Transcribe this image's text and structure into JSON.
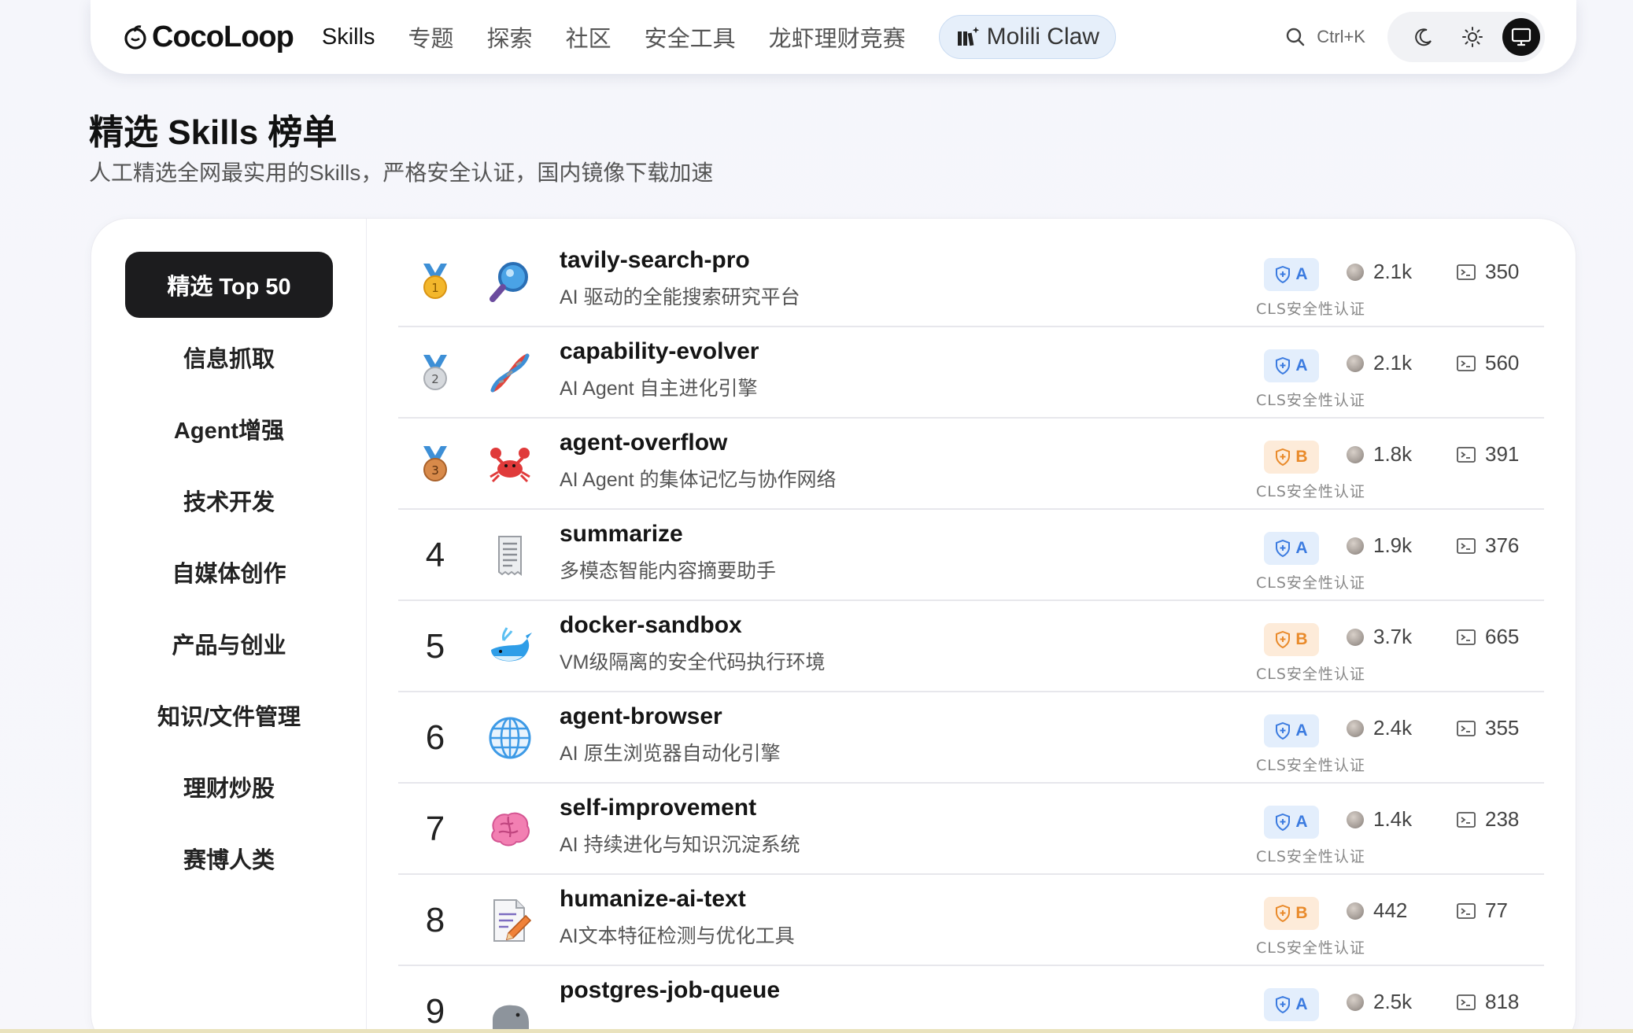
{
  "nav": {
    "logo_text": "CocoLoop",
    "items": [
      {
        "label": "Skills",
        "active": true
      },
      {
        "label": "专题"
      },
      {
        "label": "探索"
      },
      {
        "label": "社区"
      },
      {
        "label": "安全工具"
      },
      {
        "label": "龙虾理财竞赛"
      }
    ],
    "pill_label": "Molili Claw",
    "search_shortcut": "Ctrl+K",
    "theme_icons": [
      "moon-icon",
      "sun-icon",
      "monitor-icon"
    ]
  },
  "header": {
    "title": "精选 Skills 榜单",
    "subtitle": "人工精选全网最实用的Skills，严格安全认证，国内镜像下载加速"
  },
  "sidebar": {
    "items": [
      {
        "label": "精选 Top 50",
        "active": true
      },
      {
        "label": "信息抓取"
      },
      {
        "label": "Agent增强"
      },
      {
        "label": "技术开发"
      },
      {
        "label": "自媒体创作"
      },
      {
        "label": "产品与创业"
      },
      {
        "label": "知识/文件管理"
      },
      {
        "label": "理财炒股"
      },
      {
        "label": "赛博人类"
      }
    ]
  },
  "skills": [
    {
      "rank": "1",
      "medal": "gold",
      "icon": "magnifier-icon",
      "name": "tavily-search-pro",
      "desc": "AI 驱动的全能搜索研究平台",
      "grade": "A",
      "cert": "CLS安全性认证",
      "stars": "2.1k",
      "downloads": "350"
    },
    {
      "rank": "2",
      "medal": "silver",
      "icon": "dna-icon",
      "name": "capability-evolver",
      "desc": "AI Agent 自主进化引擎",
      "grade": "A",
      "cert": "CLS安全性认证",
      "stars": "2.1k",
      "downloads": "560"
    },
    {
      "rank": "3",
      "medal": "bronze",
      "icon": "crab-icon",
      "name": "agent-overflow",
      "desc": "AI Agent 的集体记忆与协作网络",
      "grade": "B",
      "cert": "CLS安全性认证",
      "stars": "1.8k",
      "downloads": "391"
    },
    {
      "rank": "4",
      "icon": "receipt-icon",
      "name": "summarize",
      "desc": "多模态智能内容摘要助手",
      "grade": "A",
      "cert": "CLS安全性认证",
      "stars": "1.9k",
      "downloads": "376"
    },
    {
      "rank": "5",
      "icon": "whale-icon",
      "name": "docker-sandbox",
      "desc": "VM级隔离的安全代码执行环境",
      "grade": "B",
      "cert": "CLS安全性认证",
      "stars": "3.7k",
      "downloads": "665"
    },
    {
      "rank": "6",
      "icon": "globe-icon",
      "name": "agent-browser",
      "desc": "AI 原生浏览器自动化引擎",
      "grade": "A",
      "cert": "CLS安全性认证",
      "stars": "2.4k",
      "downloads": "355"
    },
    {
      "rank": "7",
      "icon": "brain-icon",
      "name": "self-improvement",
      "desc": "AI 持续进化与知识沉淀系统",
      "grade": "A",
      "cert": "CLS安全性认证",
      "stars": "1.4k",
      "downloads": "238"
    },
    {
      "rank": "8",
      "icon": "memo-icon",
      "name": "humanize-ai-text",
      "desc": "AI文本特征检测与优化工具",
      "grade": "B",
      "cert": "CLS安全性认证",
      "stars": "442",
      "downloads": "77"
    },
    {
      "rank": "9",
      "icon": "elephant-icon",
      "name": "postgres-job-queue",
      "desc": "",
      "grade": "A",
      "cert": "",
      "stars": "2.5k",
      "downloads": "818"
    }
  ],
  "colors": {
    "grade_A_bg": "#e3eefc",
    "grade_A_fg": "#3b7be0",
    "grade_B_bg": "#fdebd9",
    "grade_B_fg": "#e98a2a",
    "active_tab_bg": "#1c1c1e"
  }
}
